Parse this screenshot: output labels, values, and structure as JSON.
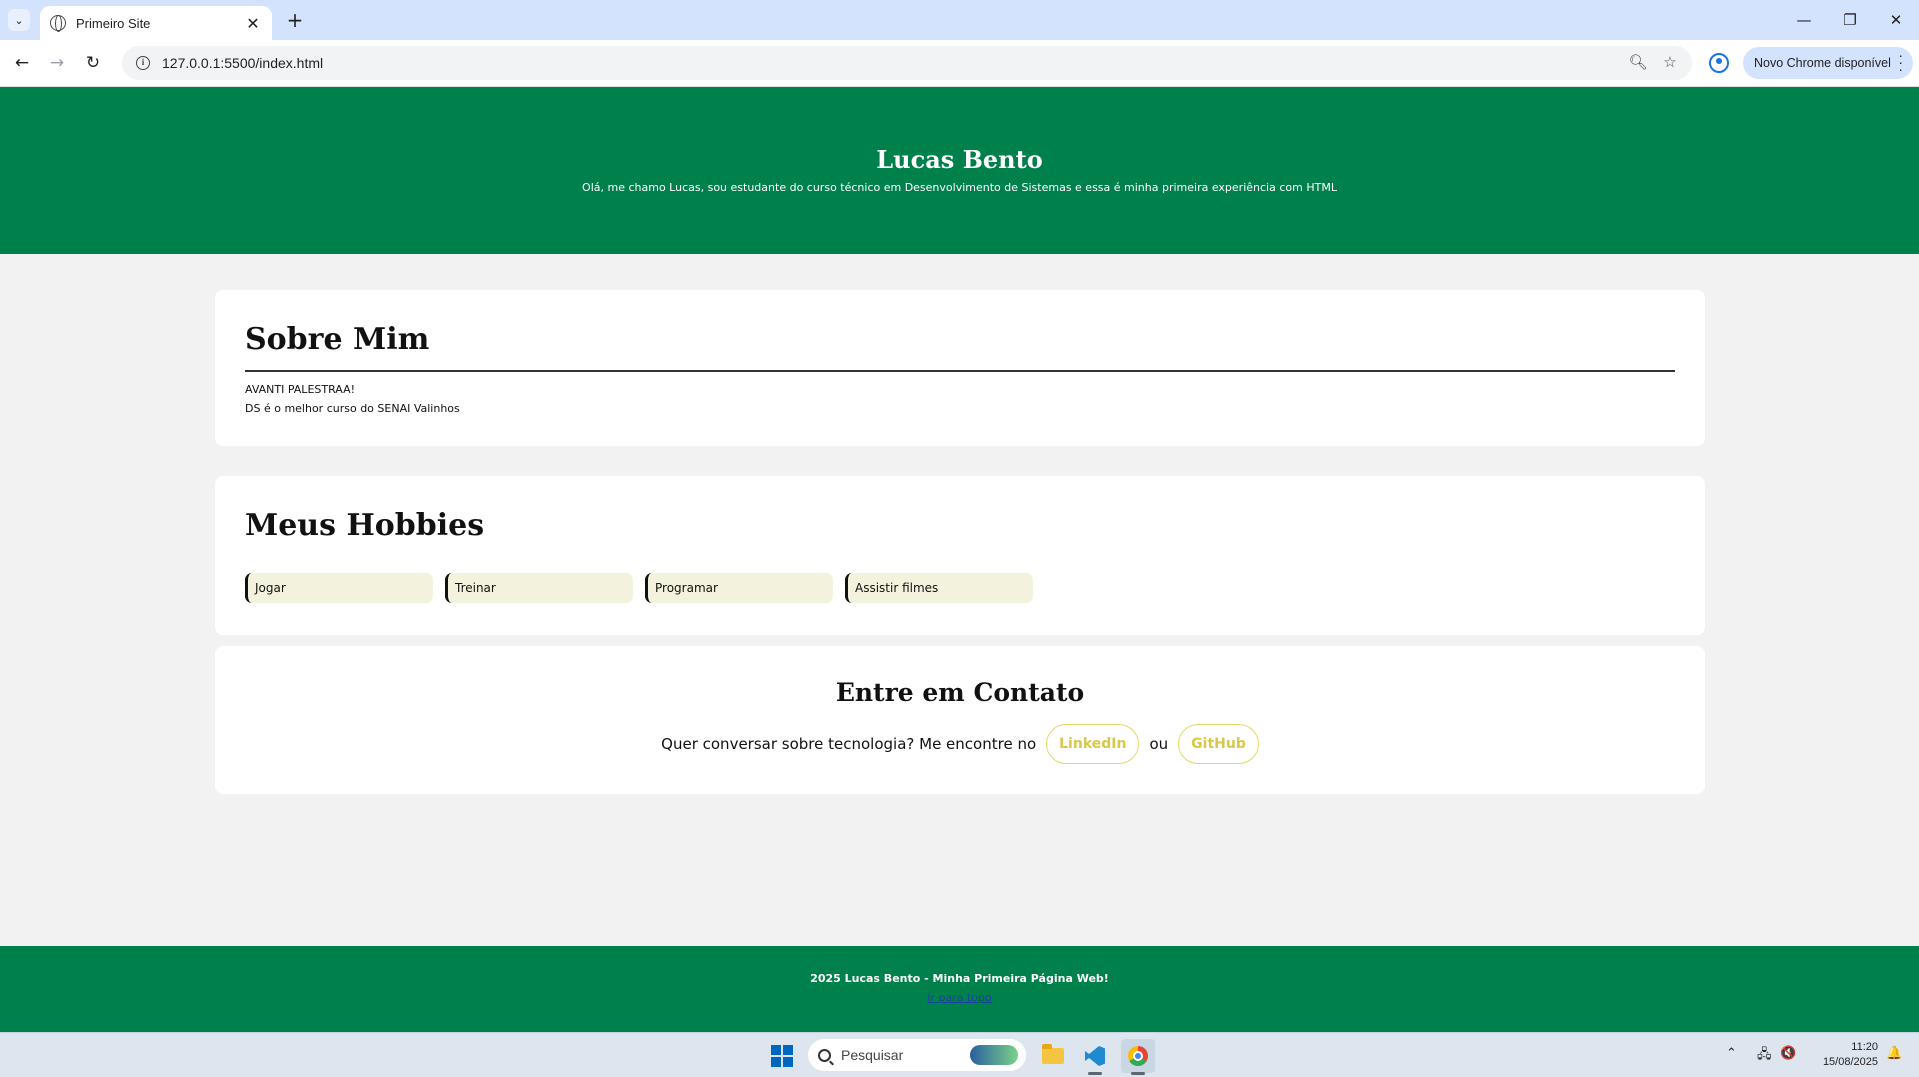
{
  "browser": {
    "tab_title": "Primeiro Site",
    "tab_close": "✕",
    "tab_list": "⌄",
    "new_tab": "+",
    "url": "127.0.0.1:5500/index.html",
    "update_label": "Novo Chrome disponível",
    "window_controls": {
      "minimize": "—",
      "restore": "❐",
      "close": "✕"
    },
    "nav": {
      "back": "←",
      "forward": "→",
      "reload": "↻"
    },
    "icons": [
      "tab-list-icon",
      "globe-icon",
      "close-icon",
      "plus-icon",
      "back-arrow-icon",
      "forward-arrow-icon",
      "reload-icon",
      "site-info-icon",
      "zoom-icon",
      "star-icon",
      "profile-icon",
      "kebab-menu-icon"
    ]
  },
  "header": {
    "title": "Lucas Bento",
    "subtitle": "Olá, me chamo Lucas, sou estudante do curso técnico em Desenvolvimento de Sistemas e essa é minha primeira experiência com HTML"
  },
  "about": {
    "heading": "Sobre Mim",
    "line1": "AVANTI PALESTRAA!",
    "line2": "DS é o melhor curso do SENAI Valinhos"
  },
  "hobbies": {
    "heading": "Meus Hobbies",
    "items": [
      "Jogar",
      "Treinar",
      "Programar",
      "Assistir filmes"
    ]
  },
  "contact": {
    "heading": "Entre em Contato",
    "text": "Quer conversar sobre tecnologia? Me encontre no",
    "link1": "LinkedIn",
    "separator": "ou",
    "link2": "GitHub"
  },
  "footer": {
    "copyright": "2025 Lucas Bento - Minha Primeira Página Web!",
    "top_link": "Ir para topo"
  },
  "taskbar": {
    "search_placeholder": "Pesquisar",
    "time": "11:20",
    "date": "15/08/2025",
    "tray": {
      "chevron": "⌃",
      "network": "🖧",
      "volume": "🔇",
      "bell": "🔔"
    }
  },
  "colors": {
    "brand_green": "#00804a",
    "page_bg": "#f2f2f2",
    "hobby_bg": "#f3f3dd",
    "link_gold": "#d8c84a"
  }
}
